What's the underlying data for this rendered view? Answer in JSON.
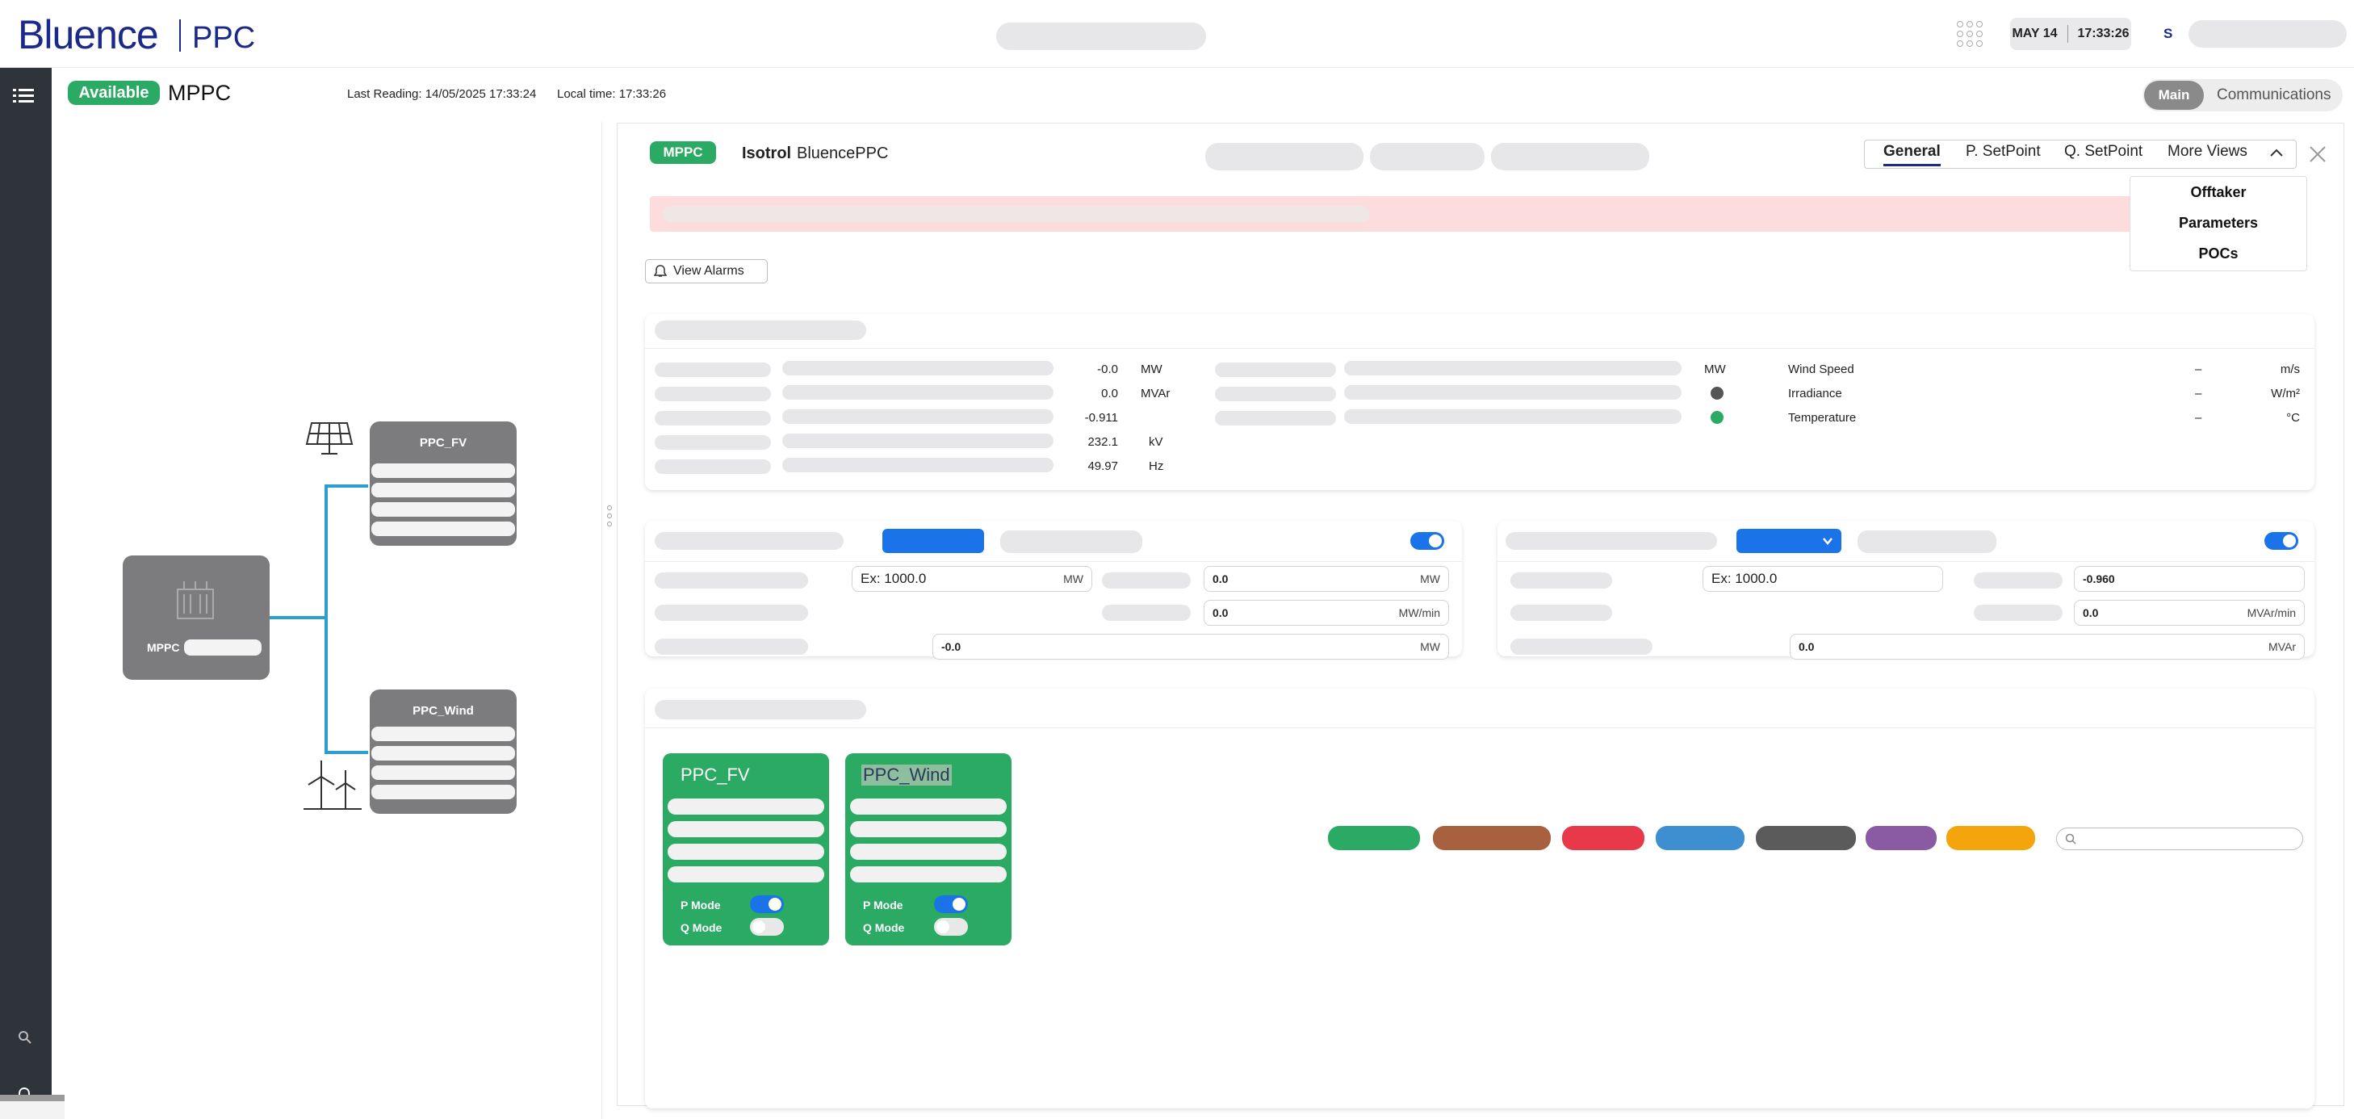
{
  "header": {
    "logo": "Bluence",
    "logo_product": "PPC",
    "date": "MAY 14",
    "time": "17:33:26",
    "user_initial": "S"
  },
  "status": {
    "badge": "Available",
    "title": "MPPC",
    "last_reading": "Last Reading: 14/05/2025 17:33:24",
    "local_time": "Local time: 17:33:26",
    "view_main": "Main",
    "view_comms": "Communications"
  },
  "diagram": {
    "main_node": "MPPC",
    "node_fv": "PPC_FV",
    "node_wind": "PPC_Wind"
  },
  "panel": {
    "badge": "MPPC",
    "company": "Isotrol",
    "name": "BluencePPC",
    "tabs": [
      "General",
      "P. SetPoint",
      "Q. SetPoint",
      "More Views"
    ],
    "more_views": [
      "Offtaker",
      "Parameters",
      "POCs"
    ],
    "view_alarms": "View Alarms"
  },
  "measurements": {
    "left": [
      {
        "value": "-0.0",
        "unit": "MW"
      },
      {
        "value": "0.0",
        "unit": "MVAr"
      },
      {
        "value": "-0.911",
        "unit": ""
      },
      {
        "value": "232.1",
        "unit": "kV"
      },
      {
        "value": "49.97",
        "unit": "Hz"
      }
    ],
    "mid_unit": "MW",
    "weather": [
      {
        "label": "Wind Speed",
        "value": "–",
        "unit": "m/s"
      },
      {
        "label": "Irradiance",
        "value": "–",
        "unit": "W/m²"
      },
      {
        "label": "Temperature",
        "value": "–",
        "unit": "°C"
      }
    ]
  },
  "p_control": {
    "placeholder": "Ex: 1000.0",
    "placeholder_unit": "MW",
    "setpoint": "0.0",
    "setpoint_unit": "MW",
    "ramp": "0.0",
    "ramp_unit": "MW/min",
    "current": "-0.0",
    "current_unit": "MW"
  },
  "q_control": {
    "placeholder": "Ex: 1000.0",
    "setpoint": "-0.960",
    "setpoint_unit": "",
    "ramp": "0.0",
    "ramp_unit": "MVAr/min",
    "current": "0.0",
    "current_unit": "MVAr"
  },
  "filter_colors": [
    "#2aaa62",
    "#a8613f",
    "#e8394a",
    "#3d8fd1",
    "#5b5b5b",
    "#8a5ba3",
    "#f5a50c"
  ],
  "ppc_cards": [
    {
      "name": "PPC_FV",
      "p_mode": "P Mode",
      "q_mode": "Q Mode",
      "p_on": true,
      "q_on": false
    },
    {
      "name": "PPC_Wind",
      "p_mode": "P Mode",
      "q_mode": "Q Mode",
      "p_on": true,
      "q_on": false
    }
  ]
}
